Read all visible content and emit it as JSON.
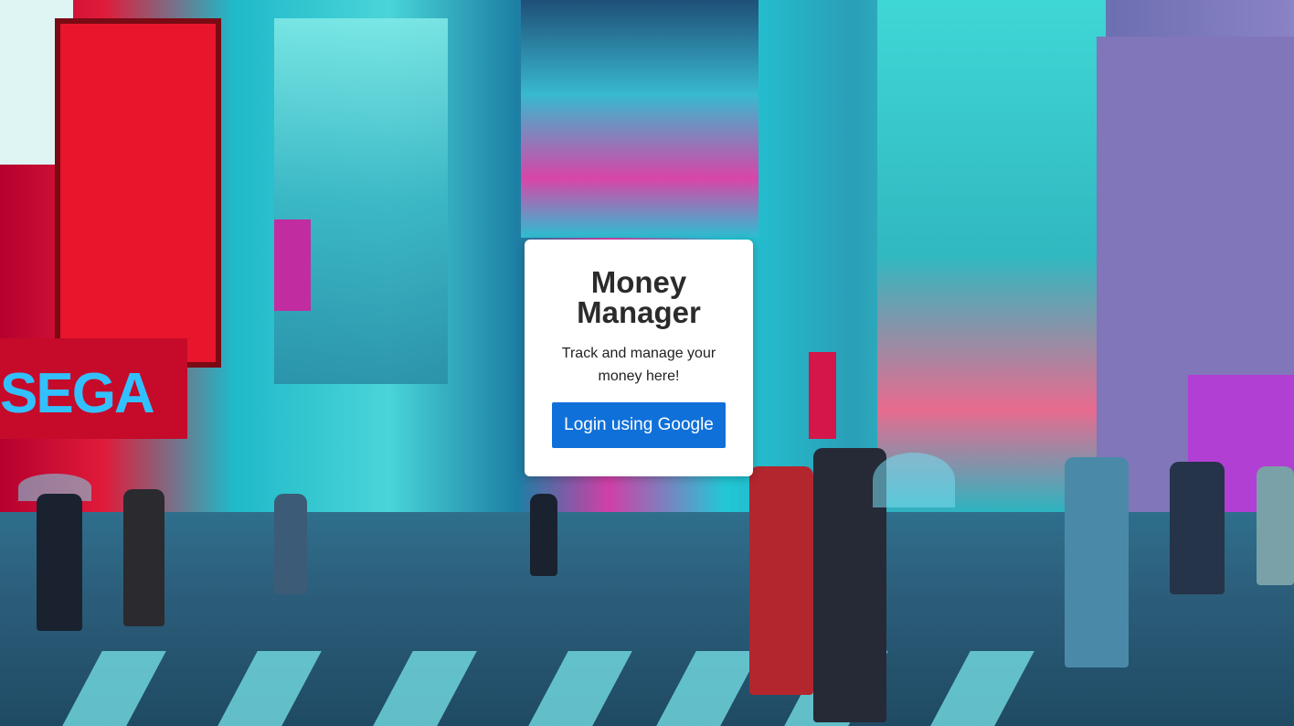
{
  "app": {
    "title": "Money Manager",
    "subtitle": "Track and manage your money here!"
  },
  "login": {
    "button_label": "Login using Google"
  },
  "background": {
    "description_icon": "city-street-photo",
    "sign_text": "SEGA"
  },
  "colors": {
    "card_bg": "#ffffff",
    "button_bg": "#1070d9",
    "button_text": "#ffffff",
    "title_text": "#2b2b2b"
  }
}
